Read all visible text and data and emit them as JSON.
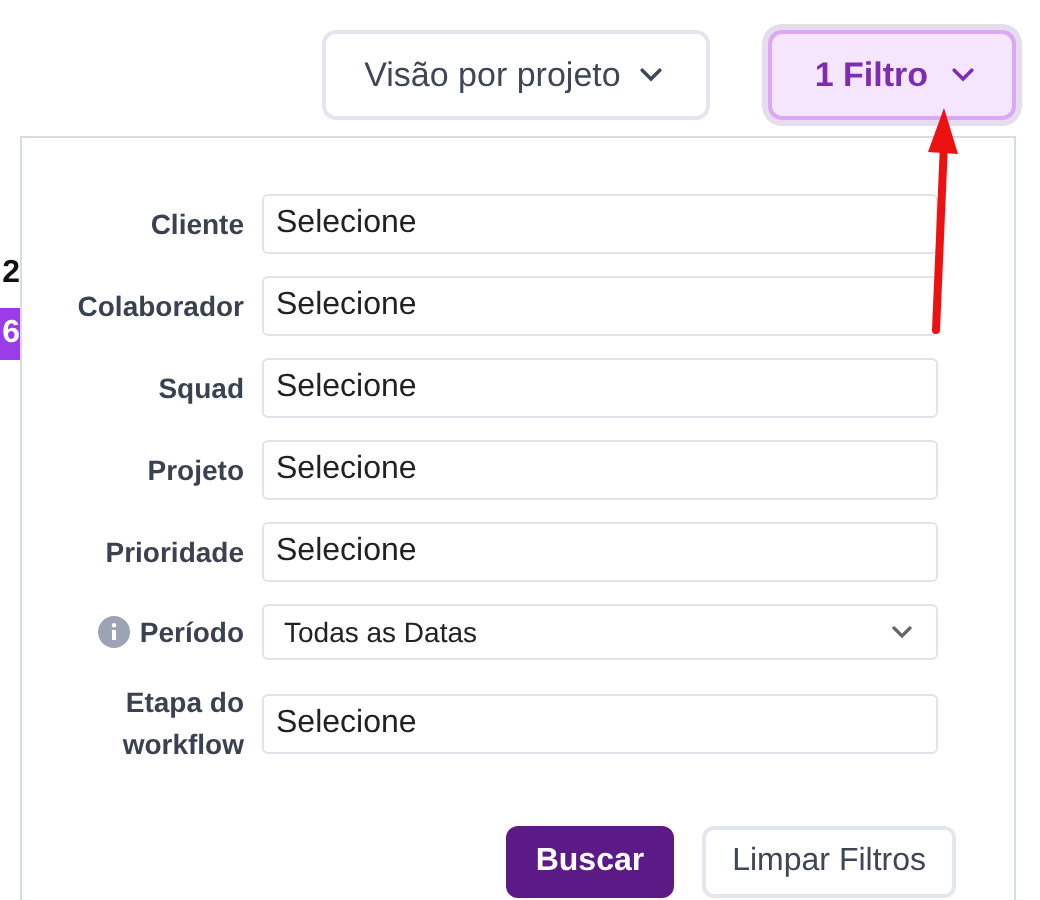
{
  "toolbar": {
    "view_button": {
      "label": "Visão por projeto"
    },
    "filter_button": {
      "label": "1 Filtro",
      "active": true
    }
  },
  "background": {
    "cell_texts": [
      {
        "text": "2",
        "highlighted": false
      },
      {
        "text": "6",
        "highlighted": true
      }
    ]
  },
  "filter_panel": {
    "fields": [
      {
        "label": "Cliente",
        "kind": "input",
        "value": "Selecione"
      },
      {
        "label": "Colaborador",
        "kind": "input",
        "value": "Selecione"
      },
      {
        "label": "Squad",
        "kind": "input",
        "value": "Selecione"
      },
      {
        "label": "Projeto",
        "kind": "input",
        "value": "Selecione"
      },
      {
        "label": "Prioridade",
        "kind": "input",
        "value": "Selecione"
      },
      {
        "label": "Período",
        "kind": "select",
        "value": "Todas as Datas",
        "info": true
      },
      {
        "label": "Etapa do workflow",
        "kind": "input",
        "value": "Selecione"
      }
    ],
    "buttons": [
      {
        "label": "Buscar",
        "kind": "primary"
      },
      {
        "label": "Limpar Filtros",
        "kind": "secondary"
      }
    ]
  }
}
